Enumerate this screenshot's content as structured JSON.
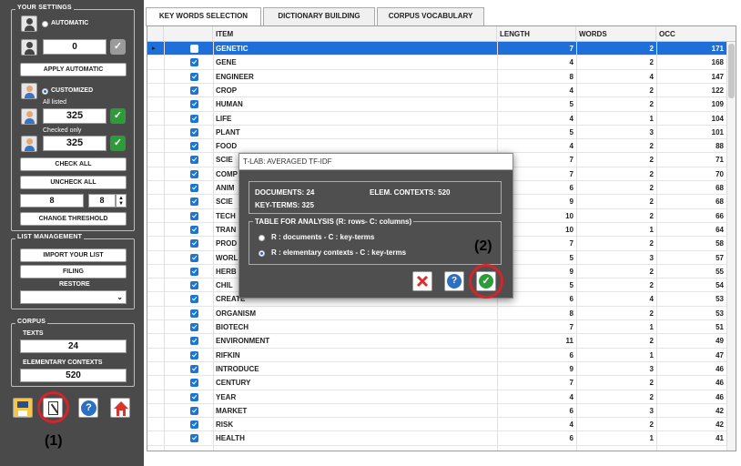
{
  "settings": {
    "title": "YOUR SETTINGS",
    "automatic_label": "AUTOMATIC",
    "automatic_value": "0",
    "apply_automatic": "APPLY AUTOMATIC",
    "customized_label": "CUSTOMIZED",
    "all_listed_label": "All listed",
    "all_listed_value": "325",
    "checked_only_label": "Checked only",
    "checked_only_value": "325",
    "check_all": "CHECK ALL",
    "uncheck_all": "UNCHECK ALL",
    "threshold_a": "8",
    "threshold_b": "8",
    "change_threshold": "CHANGE THRESHOLD"
  },
  "list_management": {
    "title": "LIST MANAGEMENT",
    "import": "IMPORT YOUR LIST",
    "filing": "FILING",
    "restore": "RESTORE"
  },
  "corpus": {
    "title": "CORPUS",
    "texts_label": "TEXTS",
    "texts_value": "24",
    "contexts_label": "ELEMENTARY CONTEXTS",
    "contexts_value": "520"
  },
  "tabs": [
    "KEY WORDS SELECTION",
    "DICTIONARY BUILDING",
    "CORPUS VOCABULARY"
  ],
  "table": {
    "headers": [
      "ITEM",
      "LENGTH",
      "WORDS",
      "OCC"
    ],
    "rows": [
      [
        "GENETIC",
        "7",
        "2",
        "171"
      ],
      [
        "GENE",
        "4",
        "2",
        "168"
      ],
      [
        "ENGINEER",
        "8",
        "4",
        "147"
      ],
      [
        "CROP",
        "4",
        "2",
        "122"
      ],
      [
        "HUMAN",
        "5",
        "2",
        "109"
      ],
      [
        "LIFE",
        "4",
        "1",
        "104"
      ],
      [
        "PLANT",
        "5",
        "3",
        "101"
      ],
      [
        "FOOD",
        "4",
        "2",
        "88"
      ],
      [
        "SCIE",
        "7",
        "2",
        "71"
      ],
      [
        "COMP",
        "7",
        "2",
        "70"
      ],
      [
        "ANIM",
        "6",
        "2",
        "68"
      ],
      [
        "SCIE",
        "9",
        "2",
        "68"
      ],
      [
        "TECH",
        "10",
        "2",
        "66"
      ],
      [
        "TRAN",
        "10",
        "1",
        "64"
      ],
      [
        "PROD",
        "7",
        "2",
        "58"
      ],
      [
        "WORL",
        "5",
        "3",
        "57"
      ],
      [
        "HERB",
        "9",
        "2",
        "55"
      ],
      [
        "CHIL",
        "5",
        "2",
        "54"
      ],
      [
        "CREATE",
        "6",
        "4",
        "53"
      ],
      [
        "ORGANISM",
        "8",
        "2",
        "53"
      ],
      [
        "BIOTECH",
        "7",
        "1",
        "51"
      ],
      [
        "ENVIRONMENT",
        "11",
        "2",
        "49"
      ],
      [
        "RIFKIN",
        "6",
        "1",
        "47"
      ],
      [
        "INTRODUCE",
        "9",
        "3",
        "46"
      ],
      [
        "CENTURY",
        "7",
        "2",
        "46"
      ],
      [
        "YEAR",
        "4",
        "2",
        "46"
      ],
      [
        "MARKET",
        "6",
        "3",
        "42"
      ],
      [
        "RISK",
        "4",
        "2",
        "42"
      ],
      [
        "HEALTH",
        "6",
        "1",
        "41"
      ]
    ]
  },
  "dialog": {
    "title": "T-LAB: AVERAGED TF-IDF",
    "documents": "DOCUMENTS:  24",
    "elem_contexts": "ELEM. CONTEXTS:  520",
    "key_terms": "KEY-TERMS:  325",
    "analysis_title": "TABLE FOR ANALYSIS (R: rows- C: columns)",
    "option1": "R : documents - C : key-terms",
    "option2": "R : elementary contexts - C : key-terms"
  },
  "annotations": {
    "one": "(1)",
    "two": "(2)"
  },
  "colors": {
    "selected_row": "#1e6fd9",
    "panel": "#4a4a4a",
    "highlight": "#d8232a",
    "ok": "#2e9b3a"
  }
}
